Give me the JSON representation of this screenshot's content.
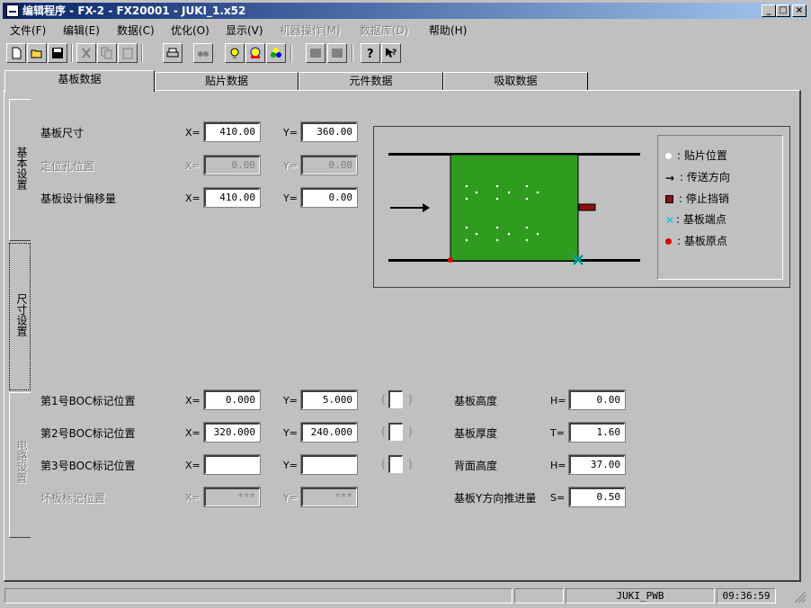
{
  "window": {
    "title": "编辑程序 - FX-2 - FX20001 - JUKI_1.x52",
    "minimize": "_",
    "maximize": "□",
    "close": "×"
  },
  "menu": [
    {
      "label": "文件(F)",
      "enabled": true
    },
    {
      "label": "编辑(E)",
      "enabled": true
    },
    {
      "label": "数据(C)",
      "enabled": true
    },
    {
      "label": "优化(O)",
      "enabled": true
    },
    {
      "label": "显示(V)",
      "enabled": true
    },
    {
      "label": "机器操作(M)",
      "enabled": false
    },
    {
      "label": "数据库(D)",
      "enabled": false
    },
    {
      "label": "帮助(H)",
      "enabled": true
    }
  ],
  "toolbar": [
    "new-icon",
    "open-icon",
    "save-icon",
    "cut-icon",
    "copy-icon",
    "paste-icon",
    "print-icon",
    "find-icon",
    "light-icon",
    "optimize-icon",
    "component-icon",
    "machine-icon",
    "machine2-icon",
    "help-icon",
    "context-help-icon"
  ],
  "tabs": [
    "基板数据",
    "贴片数据",
    "元件数据",
    "吸取数据"
  ],
  "side_tabs": [
    "基本设置",
    "尺寸设置",
    "电路设置"
  ],
  "board": {
    "size_label": "基板尺寸",
    "size_x": "410.00",
    "size_y": "360.00",
    "locate_label": "定位孔位置",
    "locate_x": "0.00",
    "locate_y": "0.00",
    "offset_label": "基板设计偏移量",
    "offset_x": "410.00",
    "offset_y": "0.00",
    "x_prefix": "X=",
    "y_prefix": "Y="
  },
  "boc": [
    {
      "label": "第1号BOC标记位置",
      "x": "0.000",
      "y": "5.000"
    },
    {
      "label": "第2号BOC标记位置",
      "x": "320.000",
      "y": "240.000"
    },
    {
      "label": "第3号BOC标记位置",
      "x": "",
      "y": ""
    }
  ],
  "bad_mark": {
    "label": "坏板标记位置",
    "x": "***",
    "y": "***"
  },
  "paren_open": "(",
  "paren_close": ")",
  "right_fields": [
    {
      "label": "基板高度",
      "prefix": "H=",
      "value": "0.00"
    },
    {
      "label": "基板厚度",
      "prefix": "T=",
      "value": "1.60"
    },
    {
      "label": "背面高度",
      "prefix": "H=",
      "value": "37.00"
    },
    {
      "label": "基板Y方向推进量",
      "prefix": "S=",
      "value": "0.50"
    }
  ],
  "legend": [
    {
      "symbol": "white-dot-icon",
      "text": ": 贴片位置"
    },
    {
      "symbol": "arrow-right-icon",
      "text": ": 传送方向"
    },
    {
      "symbol": "red-square-icon",
      "text": ": 停止挡销"
    },
    {
      "symbol": "cyan-x-icon",
      "text": ": 基板端点"
    },
    {
      "symbol": "red-dot-icon",
      "text": ": 基板原点"
    }
  ],
  "colors": {
    "board": "#2f9b1f",
    "stopper": "#8b1010",
    "endpoint": "#00e0e0",
    "origin": "#e00000",
    "title_start": "#08246b"
  },
  "status": {
    "pane1": "",
    "pane2": "",
    "profile": "JUKI_PWB",
    "time": "09:36:59"
  }
}
